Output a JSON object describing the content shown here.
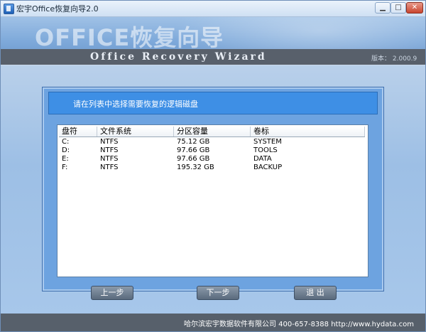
{
  "window": {
    "title": "宏宇Office恢复向导2.0"
  },
  "header": {
    "title": "OFFICE恢复向导",
    "subtitle": "Office Recovery Wizard",
    "version_label": "版本：",
    "version": "2.000.9"
  },
  "instruction": "请在列表中选择需要恢复的逻辑磁盘",
  "table": {
    "columns": [
      "盘符",
      "文件系统",
      "分区容量",
      "卷标"
    ],
    "rows": [
      [
        "C:",
        "NTFS",
        "75.12 GB",
        "SYSTEM"
      ],
      [
        "D:",
        "NTFS",
        "97.66 GB",
        "TOOLS"
      ],
      [
        "E:",
        "NTFS",
        "97.66 GB",
        "DATA"
      ],
      [
        "F:",
        "NTFS",
        "195.32 GB",
        "BACKUP"
      ]
    ]
  },
  "buttons": {
    "prev": "上一步",
    "next": "下一步",
    "exit": "退  出"
  },
  "footer": {
    "text": "哈尔滨宏宇数据软件有限公司   400-657-8388      http://www.hydata.com"
  },
  "colors": {
    "accent": "#3e8fe5",
    "dark_band": "#57606b",
    "background": "#a7c7ea"
  }
}
